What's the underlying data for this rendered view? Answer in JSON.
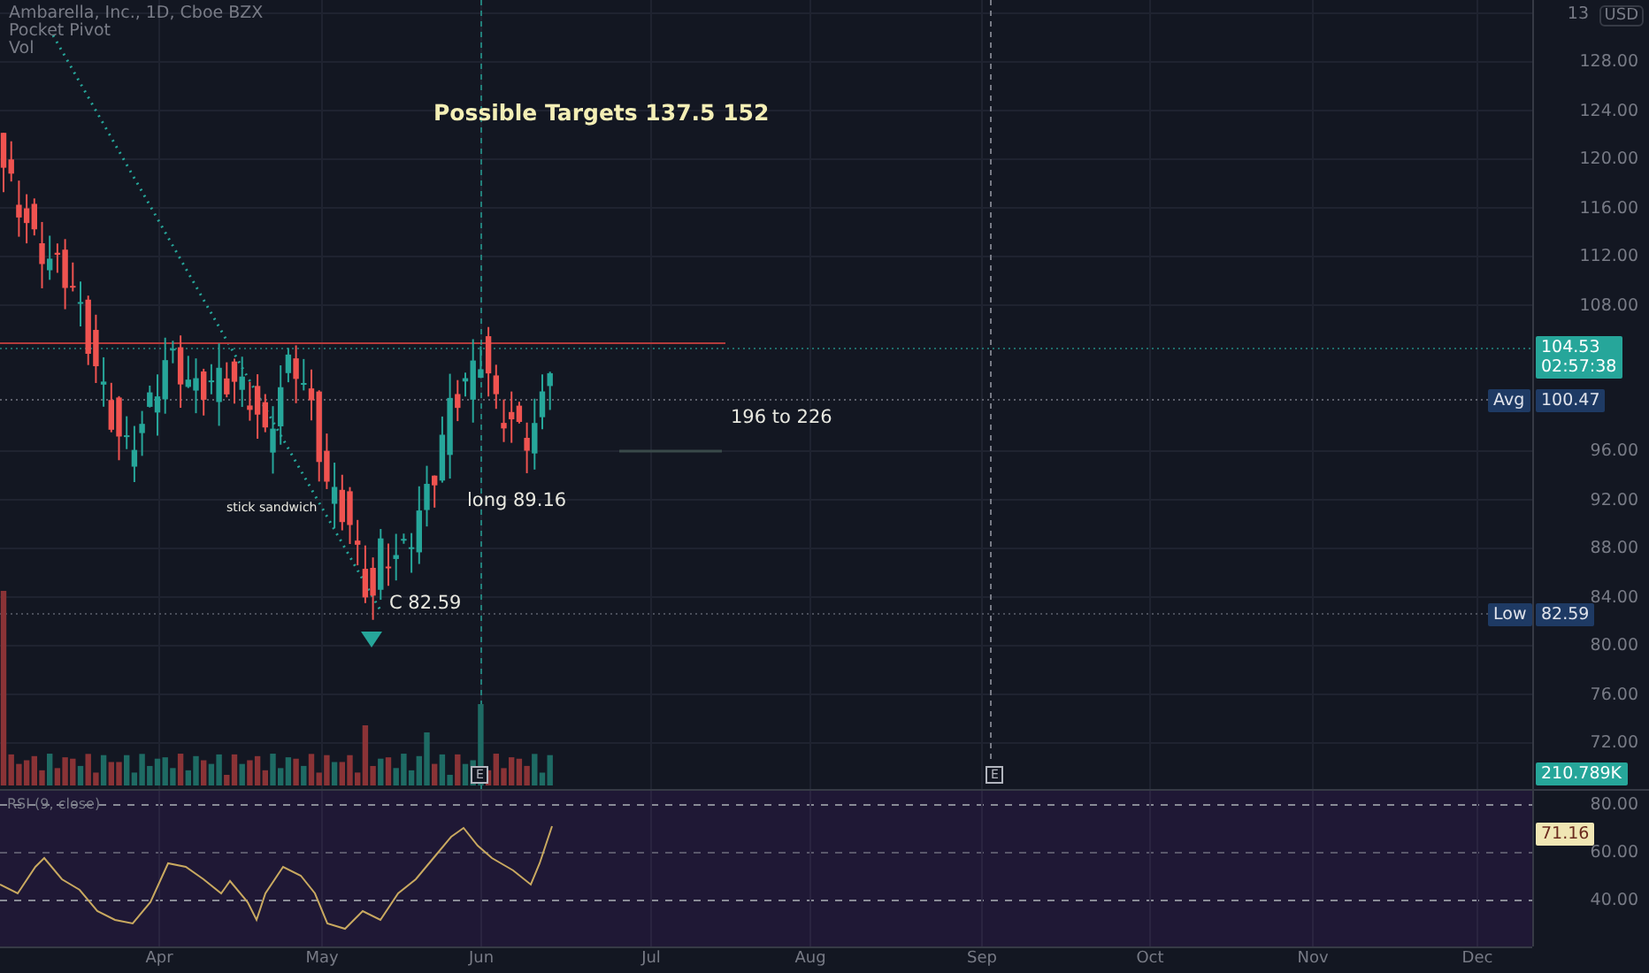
{
  "legend": [
    "Ambarella, Inc., 1D, Cboe BZX",
    "Pocket Pivot",
    "Vol"
  ],
  "annotations": [
    {
      "kind": "target",
      "text": "Possible Targets  137.5  152"
    },
    {
      "kind": "note",
      "text": "196 to 226"
    },
    {
      "kind": "note",
      "text": "long 89.16"
    },
    {
      "kind": "small",
      "text": "stick sandwich"
    },
    {
      "kind": "note",
      "text": "C  82.59"
    }
  ],
  "earnings": [
    "E",
    "E"
  ],
  "price_axis": {
    "currency": "USD",
    "ticks": [
      "13",
      "128.00",
      "124.00",
      "120.00",
      "116.00",
      "112.00",
      "108.00",
      "96.00",
      "92.00",
      "88.00",
      "84.00",
      "80.00",
      "76.00",
      "72.00"
    ]
  },
  "markers": [
    {
      "label": "Avg",
      "value": "100.47"
    },
    {
      "label": "Low",
      "value": "82.59"
    }
  ],
  "last_price": {
    "price": "104.53",
    "countdown": "02:57:38"
  },
  "volume": {
    "value": "210.789K"
  },
  "rsi": {
    "title": "RSI (9, close)",
    "value": "71.16",
    "ticks": [
      "80.00",
      "60.00",
      "40.00"
    ]
  },
  "time_axis": [
    "Apr",
    "May",
    "Jun",
    "Jul",
    "Aug",
    "Sep",
    "Oct",
    "Nov",
    "Dec"
  ]
}
